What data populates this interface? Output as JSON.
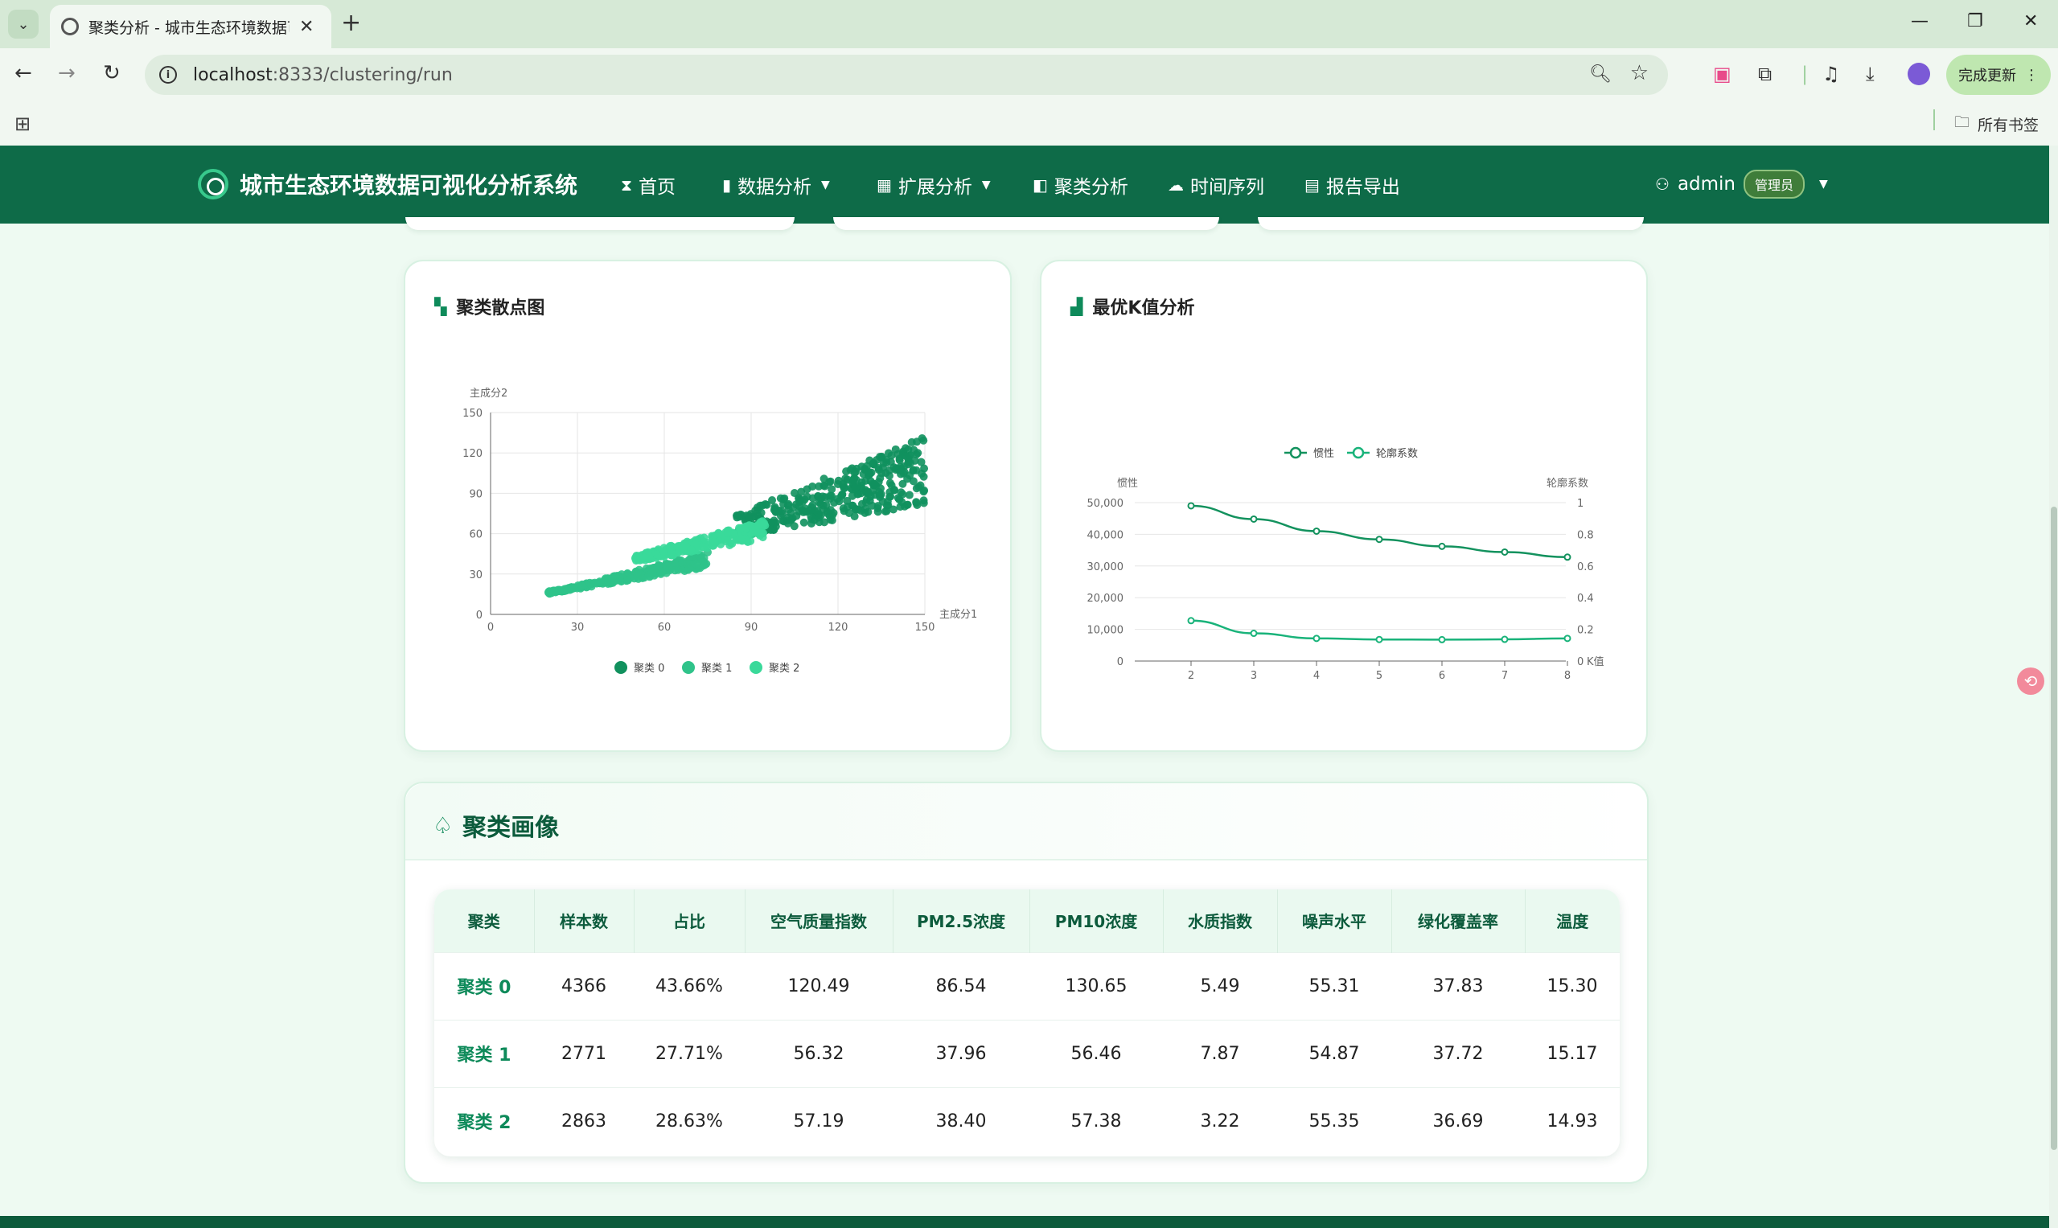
{
  "browser": {
    "tab_title": "聚类分析 - 城市生态环境数据可",
    "url_host": "localhost",
    "url_rest": ":8333/clustering/run",
    "update_label": "完成更新",
    "bookmarks_label": "所有书签"
  },
  "navbar": {
    "brand": "城市生态环境数据可视化分析系统",
    "items": [
      {
        "label": "首页"
      },
      {
        "label": "数据分析"
      },
      {
        "label": "扩展分析"
      },
      {
        "label": "聚类分析"
      },
      {
        "label": "时间序列"
      },
      {
        "label": "报告导出"
      }
    ],
    "user": "admin",
    "role": "管理员"
  },
  "scatter_card": {
    "title": "聚类散点图"
  },
  "kvalue_card": {
    "title": "最优K值分析"
  },
  "chart_data": [
    {
      "type": "scatter",
      "xlabel": "主成分1",
      "ylabel": "主成分2",
      "xlim": [
        0,
        150
      ],
      "ylim": [
        0,
        150
      ],
      "xticks": [
        0,
        30,
        60,
        90,
        120,
        150
      ],
      "yticks": [
        0,
        30,
        60,
        90,
        120,
        150
      ],
      "legend_position": "bottom",
      "series": [
        {
          "name": "聚类 0",
          "color": "#11915e",
          "x_range": [
            85,
            150
          ],
          "y_band": "0.36x+27 to 0.88x"
        },
        {
          "name": "聚类 1",
          "color": "#2fc38a",
          "x_range": [
            20,
            75
          ],
          "y_band": "0.36x+8 to 0.55x+5"
        },
        {
          "name": "聚类 2",
          "color": "#3ad99a",
          "x_range": [
            50,
            95
          ],
          "y_band": "0.38x+20 to 0.58x+15"
        }
      ]
    },
    {
      "type": "line",
      "xlabel": "K值",
      "ylabel_left": "惯性",
      "ylabel_right": "轮廓系数",
      "x": [
        2,
        3,
        4,
        5,
        6,
        7,
        8
      ],
      "ylim_left": [
        0,
        50000
      ],
      "ylim_right": [
        0,
        1
      ],
      "yticks_left": [
        "0",
        "10,000",
        "20,000",
        "30,000",
        "40,000",
        "50,000"
      ],
      "yticks_right": [
        "0",
        "0.2",
        "0.4",
        "0.6",
        "0.8",
        "1"
      ],
      "legend_position": "top",
      "series": [
        {
          "name": "惯性",
          "axis": "left",
          "color": "#13925e",
          "values": [
            49000,
            44800,
            41000,
            38400,
            36200,
            34400,
            32800
          ]
        },
        {
          "name": "轮廓系数",
          "axis": "right",
          "color": "#19b37a",
          "values": [
            0.255,
            0.175,
            0.143,
            0.136,
            0.135,
            0.137,
            0.143
          ]
        }
      ]
    }
  ],
  "profile": {
    "title": "聚类画像",
    "columns": [
      "聚类",
      "样本数",
      "占比",
      "空气质量指数",
      "PM2.5浓度",
      "PM10浓度",
      "水质指数",
      "噪声水平",
      "绿化覆盖率",
      "温度"
    ],
    "rows": [
      [
        "聚类 0",
        "4366",
        "43.66%",
        "120.49",
        "86.54",
        "130.65",
        "5.49",
        "55.31",
        "37.83",
        "15.30"
      ],
      [
        "聚类 1",
        "2771",
        "27.71%",
        "56.32",
        "37.96",
        "56.46",
        "7.87",
        "54.87",
        "37.72",
        "15.17"
      ],
      [
        "聚类 2",
        "2863",
        "28.63%",
        "57.19",
        "38.40",
        "57.38",
        "3.22",
        "55.35",
        "36.69",
        "14.93"
      ]
    ]
  }
}
